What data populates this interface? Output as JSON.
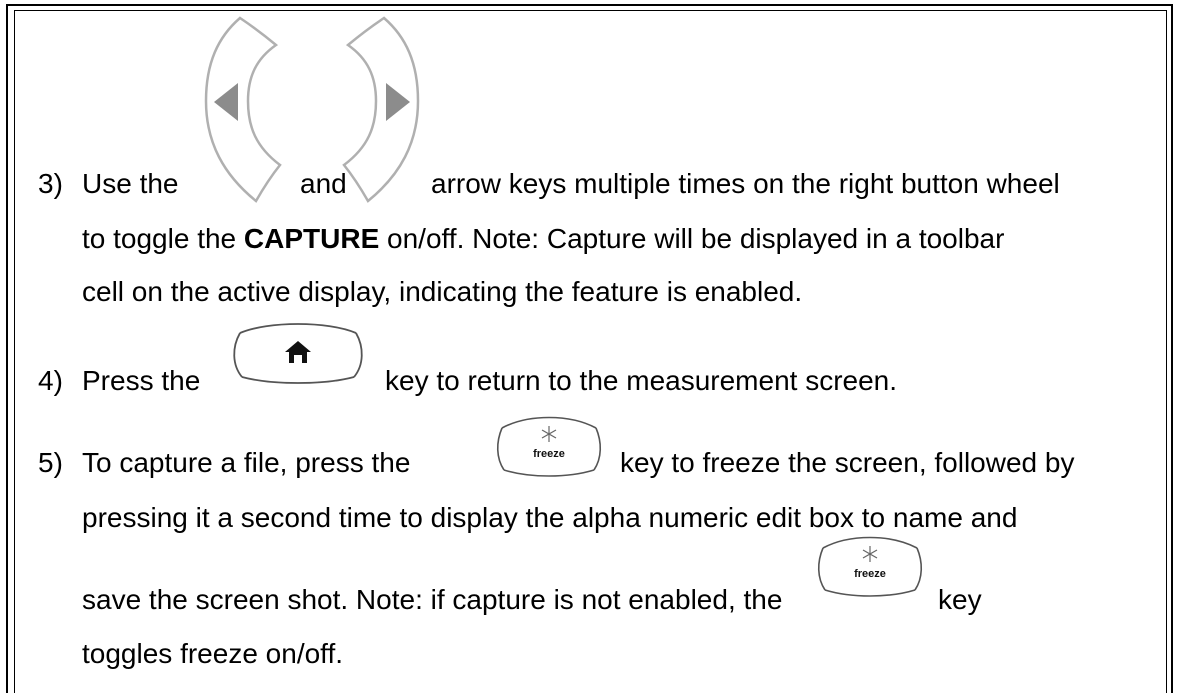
{
  "steps": [
    {
      "number": "3)",
      "line1": {
        "a": "Use the",
        "b": "and",
        "c": "arrow keys multiple times on the right button wheel"
      },
      "line2": {
        "a": "to toggle the",
        "bold": "CAPTURE",
        "b": "on/off.  Note:  Capture will be displayed in a toolbar"
      },
      "line3": "cell on the active display, indicating the feature is enabled."
    },
    {
      "number": "4)",
      "line1": {
        "a": "Press the",
        "b": "key to return to the measurement screen."
      }
    },
    {
      "number": "5)",
      "line1": {
        "a": "To capture a file, press the",
        "b": "key to freeze the screen, followed by"
      },
      "line2": "pressing it a second time to display the alpha numeric edit box to name and",
      "line3": {
        "a": "save the screen shot.  Note: if capture is not enabled, the",
        "b": "key"
      },
      "line4": "toggles freeze on/off."
    }
  ],
  "keys": {
    "freeze_label": "freeze",
    "left_arrow_icon": "left-arrow-key-icon",
    "right_arrow_icon": "right-arrow-key-icon",
    "home_icon": "home-key-icon",
    "freeze_icon": "snowflake-icon"
  }
}
